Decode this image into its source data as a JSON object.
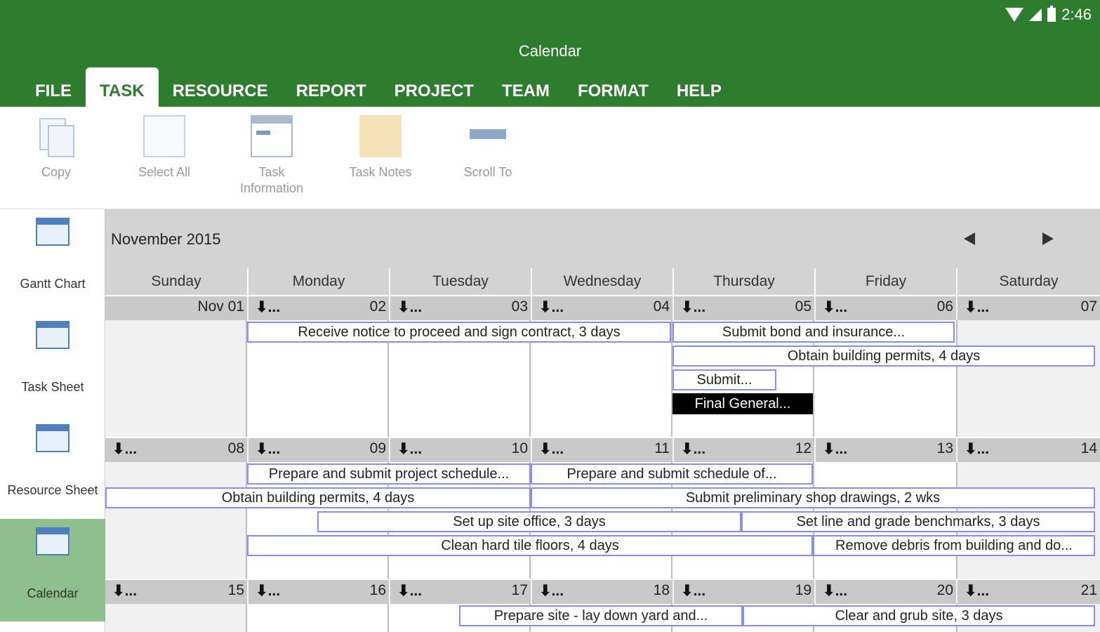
{
  "status": {
    "time": "2:46"
  },
  "app": {
    "title": "Calendar"
  },
  "tabs": [
    {
      "label": "FILE"
    },
    {
      "label": "TASK"
    },
    {
      "label": "RESOURCE"
    },
    {
      "label": "REPORT"
    },
    {
      "label": "PROJECT"
    },
    {
      "label": "TEAM"
    },
    {
      "label": "FORMAT"
    },
    {
      "label": "HELP"
    }
  ],
  "active_tab": "TASK",
  "ribbon": {
    "copy": "Copy",
    "select_all": "Select All",
    "task_information_1": "Task",
    "task_information_2": "Information",
    "task_notes": "Task Notes",
    "scroll_to": "Scroll To"
  },
  "sidebar": {
    "items": [
      {
        "label": "Gantt Chart",
        "icon": "gantt-chart-icon"
      },
      {
        "label": "Task Sheet",
        "icon": "task-sheet-icon"
      },
      {
        "label": "Resource Sheet",
        "icon": "resource-sheet-icon"
      },
      {
        "label": "Calendar",
        "icon": "calendar-icon"
      }
    ],
    "active": "Calendar"
  },
  "calendar": {
    "month": "November 2015",
    "weekdays": [
      "Sunday",
      "Monday",
      "Tuesday",
      "Wednesday",
      "Thursday",
      "Friday",
      "Saturday"
    ],
    "more_indicator": "⬇...",
    "weeks": [
      {
        "days": [
          "Nov 01",
          "02",
          "03",
          "04",
          "05",
          "06",
          "07"
        ]
      },
      {
        "days": [
          "08",
          "09",
          "10",
          "11",
          "12",
          "13",
          "14"
        ]
      },
      {
        "days": [
          "15",
          "16",
          "17",
          "18",
          "19",
          "20",
          "21"
        ]
      }
    ],
    "tasks": {
      "w1_receive": "Receive notice to proceed and sign contract, 3 days",
      "w1_bond": "Submit bond and insurance...",
      "w1_permits": "Obtain building permits, 4 days",
      "w1_submit": "Submit...",
      "w1_final": "Final General...",
      "w2_schedule": "Prepare and submit project schedule...",
      "w2_schedule_of": "Prepare and submit schedule of...",
      "w2_permits": "Obtain building permits, 4 days",
      "w2_shop": "Submit preliminary shop drawings, 2 wks",
      "w2_site_office": "Set up site office, 3 days",
      "w2_benchmarks": "Set line and grade benchmarks, 3 days",
      "w2_floors": "Clean hard tile floors, 4 days",
      "w2_debris": "Remove debris from building and do...",
      "w3_prepare_site": "Prepare site - lay down yard and...",
      "w3_clear": "Clear and grub site, 3 days"
    }
  }
}
